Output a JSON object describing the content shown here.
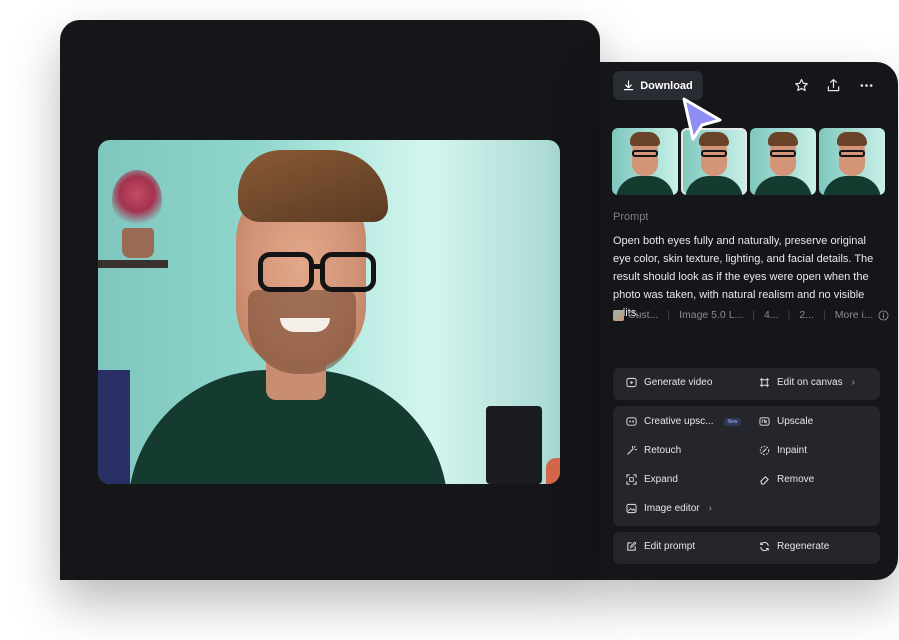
{
  "header": {
    "download_label": "Download"
  },
  "icons": {
    "download": "download-icon",
    "star": "star-icon",
    "share": "share-icon",
    "more": "more-icon"
  },
  "prompt": {
    "label": "Prompt",
    "text": "Open both eyes fully and naturally, preserve original eye color, skin texture, lighting, and facial details. The result should look as if the eyes were open when the photo was taken, with natural realism and no visible edits."
  },
  "meta": {
    "style": "Cust...",
    "model": "Image 5.0 L...",
    "count": "4...",
    "ratio": "2...",
    "more": "More i..."
  },
  "actions_primary": [
    {
      "label": "Generate video"
    },
    {
      "label": "Edit on canvas"
    }
  ],
  "actions_tools": [
    {
      "label": "Creative upsc...",
      "badge": "New"
    },
    {
      "label": "Upscale"
    },
    {
      "label": "Retouch"
    },
    {
      "label": "Inpaint"
    },
    {
      "label": "Expand"
    },
    {
      "label": "Remove"
    },
    {
      "label": "Image editor"
    }
  ],
  "actions_footer": [
    {
      "label": "Edit prompt"
    },
    {
      "label": "Regenerate"
    }
  ],
  "colors": {
    "panel_bg": "#15161a",
    "group_bg": "#24262b",
    "cursor_accent": "#8e8cf5"
  }
}
